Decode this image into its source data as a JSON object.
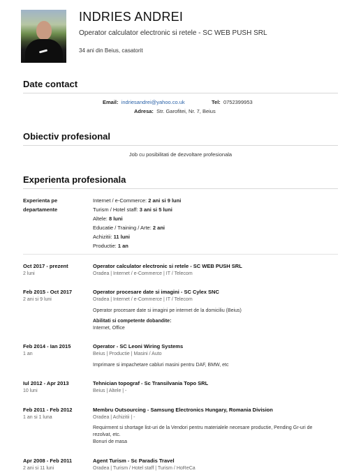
{
  "header": {
    "name": "INDRIES ANDREI",
    "title": "Operator calculator electronic si retele - SC WEB PUSH SRL",
    "age_status": "34 ani din Beius, casatorit"
  },
  "contact": {
    "section_title": "Date contact",
    "email_label": "Email:",
    "email": "indriesandrei@yahoo.co.uk",
    "tel_label": "Tel:",
    "tel": "0752399953",
    "address_label": "Adresa:",
    "address": "Str. Garofitei, Nr. 7, Beius"
  },
  "objective": {
    "section_title": "Obiectiv profesional",
    "text": "Job cu posibilitati de dezvoltare profesionala"
  },
  "experience": {
    "section_title": "Experienta profesionala",
    "departments_label_1": "Experienta pe",
    "departments_label_2": "departamente",
    "departments": [
      {
        "name": "Internet / e-Commerce: ",
        "value": "2 ani si 9 luni"
      },
      {
        "name": "Turism / Hotel staff: ",
        "value": "3 ani si 5 luni"
      },
      {
        "name": "Altele: ",
        "value": "8 luni"
      },
      {
        "name": "Educatie / Training / Arte: ",
        "value": "2 ani"
      },
      {
        "name": "Achizitii: ",
        "value": "11 luni"
      },
      {
        "name": "Productie: ",
        "value": "1 an"
      }
    ],
    "jobs": [
      {
        "period": "Oct 2017 - prezent",
        "duration": "2 luni",
        "title": "Operator calculator electronic si retele - SC WEB PUSH SRL",
        "category": "Oradea | Internet / e-Commerce | IT / Telecom"
      },
      {
        "period": "Feb 2015 - Oct 2017",
        "duration": "2 ani si 9 luni",
        "title": "Operator procesare date si imagini - SC Cylex SNC",
        "category": "Oradea | Internet / e-Commerce | IT / Telecom",
        "description": "Operator procesare date si imagini pe internet de la domiciliu (Beius)",
        "skills_label": "Abilitati si competente dobandite:",
        "skills": "Internet, Office"
      },
      {
        "period": "Feb 2014 - Ian 2015",
        "duration": "1 an",
        "title": "Operator - SC Leoni Wiring Systems",
        "category": "Beius | Productie | Masini / Auto",
        "description": "Imprimare si impachetare cabluri masini pentru DAF, BMW, etc"
      },
      {
        "period": "Iul 2012 - Apr 2013",
        "duration": "10 luni",
        "title": "Tehnician topograf - Sc Transilvania Topo SRL",
        "category": "Beius | Altele | -"
      },
      {
        "period": "Feb 2011 - Feb 2012",
        "duration": "1 an si 1 luna",
        "title": "Membru Outsourcing - Samsung Electronics Hungary, Romania Division",
        "category": "Oradea | Achizitii | -",
        "description_1": "Requirment si shortage list-uri de la Vendori pentru materialele necesare productie, Pending Gr-uri de rezolvat, etc.",
        "description_2": "Bonuri de masa"
      },
      {
        "period": "Apr 2008 - Feb 2011",
        "duration": "2 ani si 11 luni",
        "title": "Agent Turism - Sc Paradis Travel",
        "category": "Oradea | Turism / Hotel staff | Turism / HoReCa"
      }
    ]
  },
  "colors": {
    "link": "#2a62a8",
    "divider": "#d8d8d8"
  }
}
